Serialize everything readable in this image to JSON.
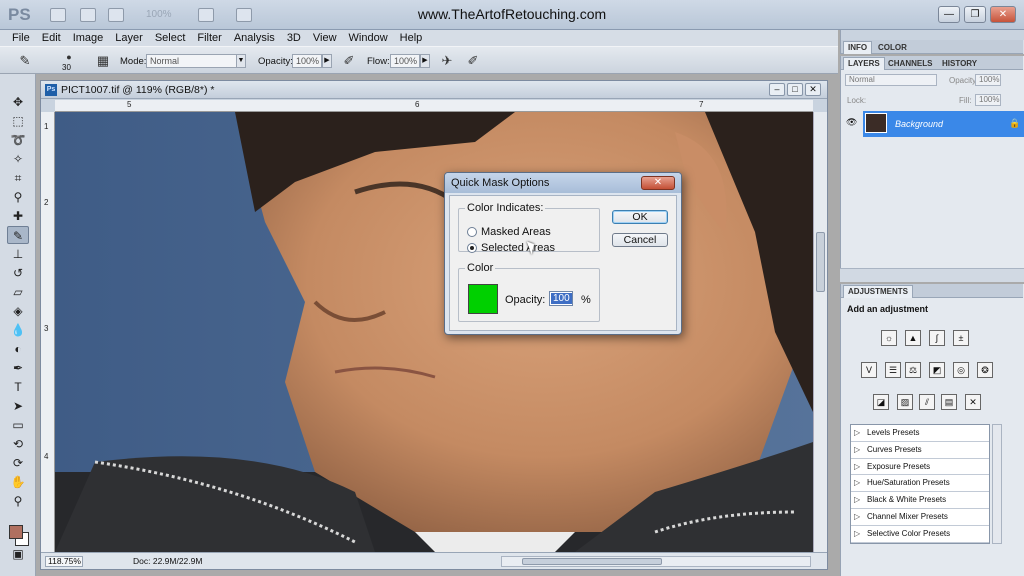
{
  "window": {
    "app_logo": "PS",
    "site_title": "www.TheArtofRetouching.com",
    "zoom_readout": "100%",
    "minimize": "—",
    "restore": "❐",
    "close": "✕"
  },
  "menu": [
    "File",
    "Edit",
    "Image",
    "Layer",
    "Select",
    "Filter",
    "Analysis",
    "3D",
    "View",
    "Window",
    "Help"
  ],
  "options_bar": {
    "brush_size": "30",
    "mode_label": "Mode:",
    "mode_value": "Normal",
    "opacity_label": "Opacity:",
    "opacity_value": "100%",
    "flow_label": "Flow:",
    "flow_value": "100%"
  },
  "document": {
    "tab_icon": "Ps",
    "title": "PICT1007.tif @ 119% (RGB/8*) *",
    "ruler_h": [
      "5",
      "6",
      "7"
    ],
    "ruler_v": [
      "1",
      "2",
      "3",
      "4"
    ],
    "zoom": "118.75%",
    "doc_info": "Doc: 22.9M/22.9M"
  },
  "dialog": {
    "title": "Quick Mask Options",
    "close_label": "✕",
    "color_indicates_label": "Color Indicates:",
    "masked_areas": "Masked Areas",
    "selected_areas": "Selected Areas",
    "selected_option": "Selected Areas",
    "color_group_label": "Color",
    "swatch_color": "#00d000",
    "opacity_label": "Opacity:",
    "opacity_value": "100",
    "percent": "%",
    "ok": "OK",
    "cancel": "Cancel"
  },
  "panels": {
    "top_tabs": [
      "INFO",
      "COLOR"
    ],
    "layer_tabs": [
      "LAYERS",
      "CHANNELS",
      "HISTORY"
    ],
    "blend_mode": "Normal",
    "opacity_label": "Opacity:",
    "opacity_value": "100%",
    "lock_label": "Lock:",
    "fill_label": "Fill:",
    "fill_value": "100%",
    "layer_name": "Background",
    "adjustments_tab": "ADJUSTMENTS",
    "add_adjustment": "Add an adjustment",
    "presets": [
      "Levels Presets",
      "Curves Presets",
      "Exposure Presets",
      "Hue/Saturation Presets",
      "Black & White Presets",
      "Channel Mixer Presets",
      "Selective Color Presets"
    ]
  },
  "colors": {
    "foreground": "#b07060",
    "background": "#ffffff",
    "layer_highlight": "#3a88e8"
  }
}
